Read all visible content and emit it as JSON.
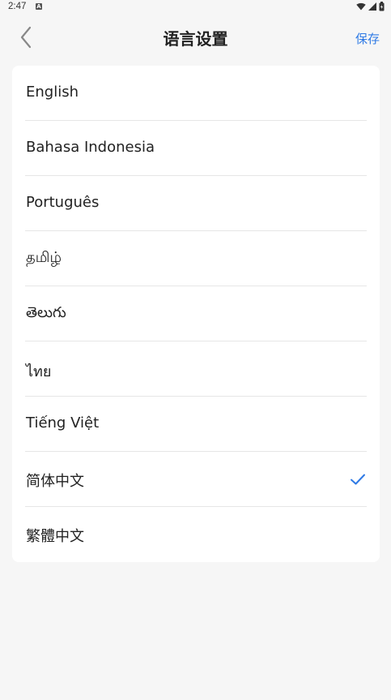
{
  "status_bar": {
    "time": "2:47",
    "notification_icon": "a-icon"
  },
  "header": {
    "title": "语言设置",
    "save_label": "保存",
    "back_icon": "chevron-left-icon"
  },
  "languages": [
    {
      "label": "English",
      "selected": false
    },
    {
      "label": "Bahasa Indonesia",
      "selected": false
    },
    {
      "label": "Português",
      "selected": false
    },
    {
      "label": "தமிழ்",
      "selected": false
    },
    {
      "label": "తెలుగు",
      "selected": false
    },
    {
      "label": "ไทย",
      "selected": false
    },
    {
      "label": "Tiếng Việt",
      "selected": false
    },
    {
      "label": "简体中文",
      "selected": true
    },
    {
      "label": "繁體中文",
      "selected": false
    }
  ],
  "colors": {
    "accent": "#2f7ae5",
    "background": "#f6f6f6",
    "card": "#ffffff"
  }
}
